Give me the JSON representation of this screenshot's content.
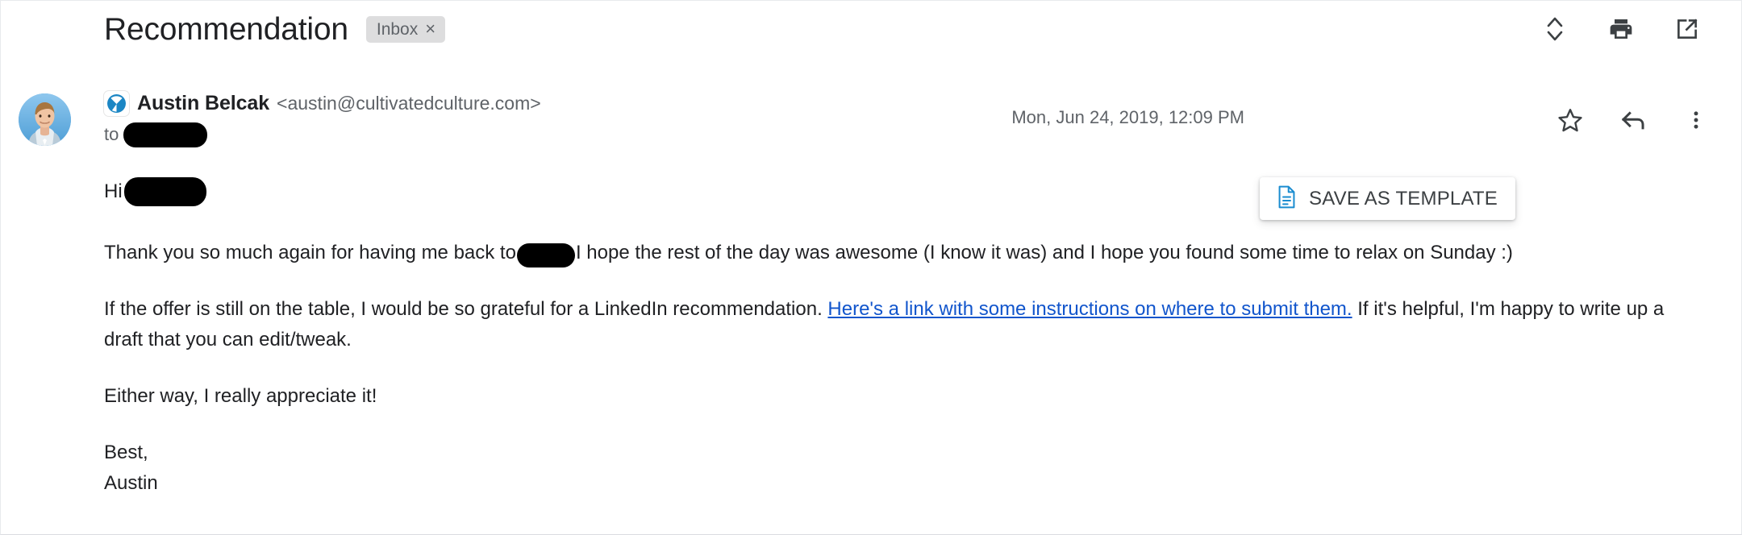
{
  "header": {
    "subject": "Recommendation",
    "label": {
      "name": "Inbox",
      "remove": "×"
    },
    "icons": [
      {
        "name": "expand-collapse-icon",
        "title": "Collapse all"
      },
      {
        "name": "print-icon",
        "title": "Print all"
      },
      {
        "name": "open-in-new-window-icon",
        "title": "In new window"
      }
    ]
  },
  "message": {
    "sender_name": "Austin Belcak",
    "sender_email": "<austin@cultivatedculture.com>",
    "to_label": "to",
    "to_recipient_redacted": "",
    "date": "Mon, Jun 24, 2019, 12:09 PM",
    "brand_icon": "yesware-logo-icon",
    "avatar": "sender-avatar-photo",
    "save_template": {
      "label": "SAVE AS TEMPLATE",
      "icon": "document-icon",
      "icon_color": "#1a8cd0"
    },
    "actions": [
      {
        "name": "star-icon",
        "title": "Not starred"
      },
      {
        "name": "reply-icon",
        "title": "Reply"
      },
      {
        "name": "more-options-icon",
        "title": "More"
      }
    ]
  },
  "body": {
    "greeting_label": "Hi",
    "greeting_redacted": "",
    "paragraph_1_before": "Thank you so much again for having me back to",
    "paragraph_1_after": "I hope the rest of the day was awesome (I know it was) and I hope you found some time to relax on Sunday :)",
    "paragraph_2_before": "If the offer is still on the table, I would be so grateful for a LinkedIn recommendation.",
    "paragraph_2_link": "Here's a link with some instructions on where to submit them.",
    "paragraph_2_after": "If it's helpful, I'm happy to write up a draft that you can edit/tweak.",
    "paragraph_3": "Either way, I really appreciate it!",
    "signoff": "Best,",
    "signature": "Austin"
  },
  "colors": {
    "text_primary": "#202124",
    "text_secondary": "#5f6368",
    "link": "#1155cc",
    "chip_bg": "#ddddde",
    "accent_blue": "#1a8cd0",
    "redaction": "#000000"
  }
}
